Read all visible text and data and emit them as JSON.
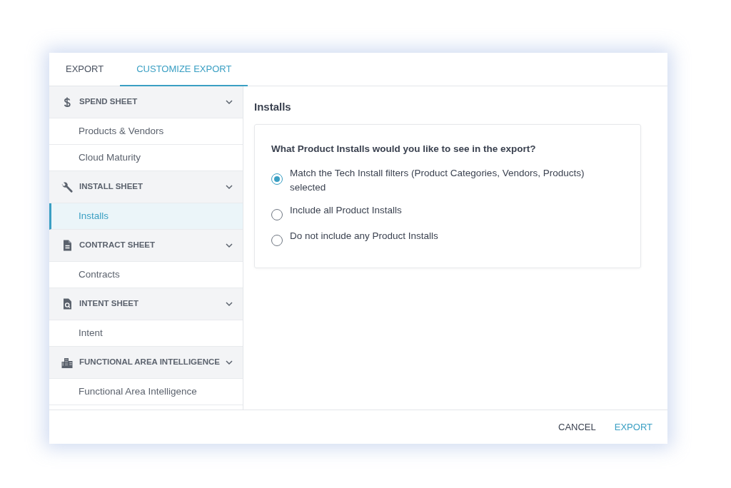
{
  "tabs": [
    {
      "label": "EXPORT",
      "selected": false
    },
    {
      "label": "CUSTOMIZE EXPORT",
      "selected": true
    }
  ],
  "sidebar": {
    "sections": [
      {
        "title": "SPEND SHEET",
        "expanded": true,
        "items": [
          {
            "label": "Products & Vendors",
            "selected": false
          },
          {
            "label": "Cloud Maturity",
            "selected": false
          }
        ]
      },
      {
        "title": "INSTALL SHEET",
        "expanded": true,
        "items": [
          {
            "label": "Installs",
            "selected": true
          }
        ]
      },
      {
        "title": "CONTRACT SHEET",
        "expanded": true,
        "items": [
          {
            "label": "Contracts",
            "selected": false
          }
        ]
      },
      {
        "title": "INTENT SHEET",
        "expanded": true,
        "items": [
          {
            "label": "Intent",
            "selected": false
          }
        ]
      },
      {
        "title": "FUNCTIONAL AREA INTELLIGENCE",
        "expanded": true,
        "items": [
          {
            "label": "Functional Area Intelligence",
            "selected": false
          }
        ]
      }
    ]
  },
  "panel": {
    "title": "Installs",
    "question": "What Product Installs would you like to see in the export?",
    "options": [
      {
        "label": "Match the Tech Install filters (Product Categories, Vendors, Products) selected",
        "selected": true
      },
      {
        "label": "Include all Product Installs",
        "selected": false
      },
      {
        "label": "Do not include any Product Installs",
        "selected": false
      }
    ]
  },
  "footer": {
    "buttons": [
      {
        "label": "CANCEL",
        "kind": "secondary"
      },
      {
        "label": "EXPORT",
        "kind": "primary"
      }
    ]
  }
}
